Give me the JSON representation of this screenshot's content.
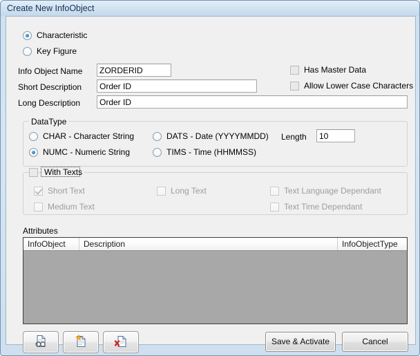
{
  "window": {
    "title": "Create New InfoObject"
  },
  "object_type": {
    "options": [
      {
        "label": "Characteristic",
        "selected": true
      },
      {
        "label": "Key Figure",
        "selected": false
      }
    ]
  },
  "fields": {
    "info_object_name": {
      "label": "Info Object Name",
      "value": "ZORDERID",
      "placeholder": ""
    },
    "short_description": {
      "label": "Short Description",
      "value": "Order ID",
      "placeholder": ""
    },
    "long_description": {
      "label": "Long Description",
      "value": "Order ID",
      "placeholder": ""
    }
  },
  "flags": {
    "has_master_data": {
      "label": "Has Master Data",
      "checked": false
    },
    "allow_lower_case": {
      "label": "Allow Lower Case Characters",
      "checked": false
    }
  },
  "datatype": {
    "title": "DataType",
    "options": [
      {
        "label": "CHAR - Character String",
        "selected": false
      },
      {
        "label": "NUMC - Numeric String",
        "selected": true
      },
      {
        "label": "DATS - Date (YYYYMMDD)",
        "selected": false
      },
      {
        "label": "TIMS - Time (HHMMSS)",
        "selected": false
      }
    ],
    "length_label": "Length",
    "length_value": "10"
  },
  "with_texts": {
    "title": "With Texts",
    "checked": false,
    "focused": true,
    "options": [
      {
        "label": "Short Text",
        "checked": true,
        "disabled": true
      },
      {
        "label": "Medium Text",
        "checked": false,
        "disabled": true
      },
      {
        "label": "Long Text",
        "checked": false,
        "disabled": true
      },
      {
        "label": "Text Language Dependant",
        "checked": false,
        "disabled": true
      },
      {
        "label": "Text Time Dependant",
        "checked": false,
        "disabled": true
      }
    ]
  },
  "attributes": {
    "label": "Attributes",
    "columns": [
      "InfoObject",
      "Description",
      "InfoObjectType"
    ],
    "rows": []
  },
  "toolbar": {
    "view_button": "document-view-icon",
    "new_button": "document-new-icon",
    "delete_button": "document-delete-icon"
  },
  "actions": {
    "save_label": "Save & Activate",
    "cancel_label": "Cancel"
  },
  "colors": {
    "frame": "#cfe0ef",
    "client": "#f0f0f0",
    "grid_body": "#a8a8a8",
    "accent": "#2a7fc0"
  }
}
